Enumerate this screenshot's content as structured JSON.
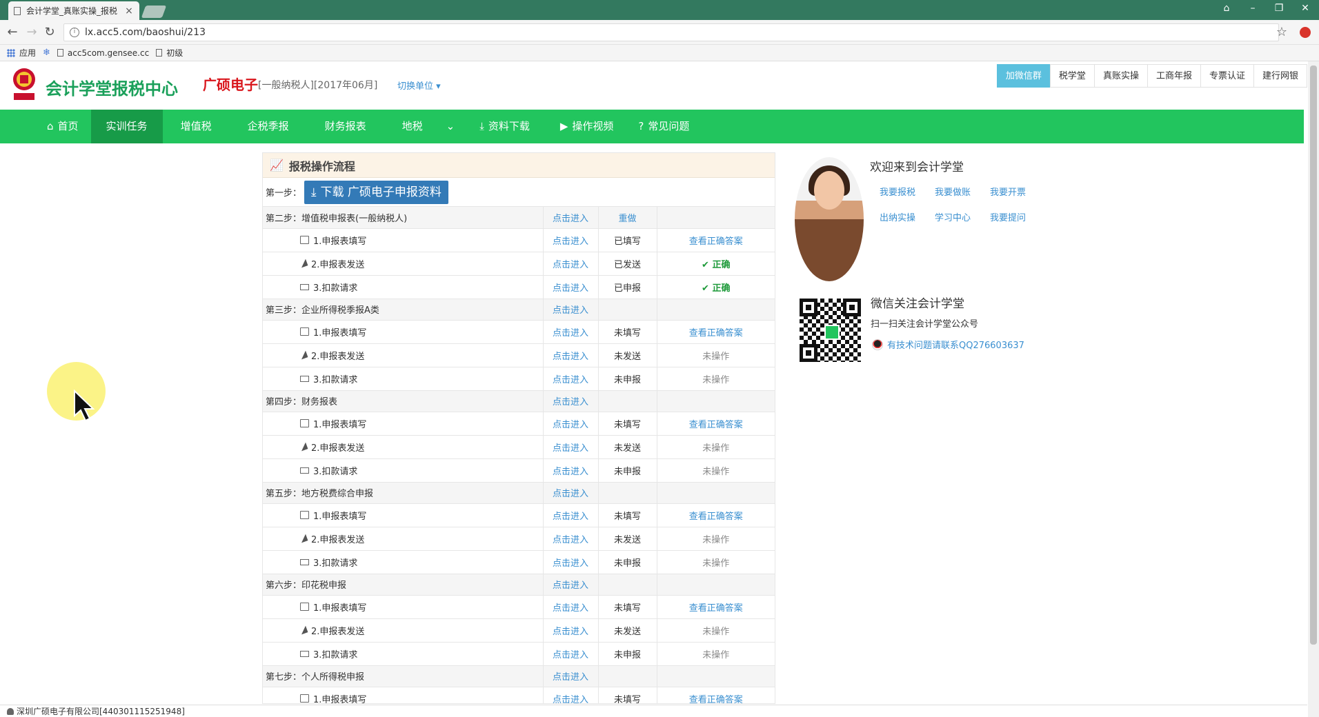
{
  "browser": {
    "tab_title": "会计学堂_真账实操_报税",
    "url": "lx.acc5.com/baoshui/213",
    "bookmarks": [
      "应用",
      "acc5com.gensee.cc",
      "初级"
    ]
  },
  "header": {
    "site_title": "会计学堂报税中心",
    "company": "广硕电子",
    "company_sub": "[一般纳税人][2017年06月]",
    "switch_unit": "切换单位 ▾",
    "top_links": [
      "加微信群",
      "税学堂",
      "真账实操",
      "工商年报",
      "专票认证",
      "建行网银"
    ]
  },
  "nav": {
    "items": [
      "首页",
      "实训任务",
      "增值税",
      "企税季报",
      "财务报表",
      "地税",
      "资料下载",
      "操作视频",
      "常见问题"
    ]
  },
  "panel": {
    "title": "报税操作流程",
    "step1_label": "第一步：",
    "download_label": "下载 广硕电子申报资料",
    "sections": [
      {
        "title": "第二步：增值税申报表(一般纳税人)",
        "link": "点击进入",
        "extra": "重做",
        "rows": [
          {
            "icon": "edit",
            "label": "1.申报表填写",
            "link": "点击进入",
            "status": "已填写",
            "answer": "查看正确答案",
            "kind": "link"
          },
          {
            "icon": "send",
            "label": "2.申报表发送",
            "link": "点击进入",
            "status": "已发送",
            "answer": "✔ 正确",
            "kind": "ok"
          },
          {
            "icon": "mon",
            "label": "3.扣款请求",
            "link": "点击进入",
            "status": "已申报",
            "answer": "✔ 正确",
            "kind": "ok"
          }
        ]
      },
      {
        "title": "第三步：企业所得税季报A类",
        "link": "点击进入",
        "extra": "",
        "rows": [
          {
            "icon": "edit",
            "label": "1.申报表填写",
            "link": "点击进入",
            "status": "未填写",
            "answer": "查看正确答案",
            "kind": "link"
          },
          {
            "icon": "send",
            "label": "2.申报表发送",
            "link": "点击进入",
            "status": "未发送",
            "answer": "未操作",
            "kind": "none"
          },
          {
            "icon": "mon",
            "label": "3.扣款请求",
            "link": "点击进入",
            "status": "未申报",
            "answer": "未操作",
            "kind": "none"
          }
        ]
      },
      {
        "title": "第四步：财务报表",
        "link": "点击进入",
        "extra": "",
        "rows": [
          {
            "icon": "edit",
            "label": "1.申报表填写",
            "link": "点击进入",
            "status": "未填写",
            "answer": "查看正确答案",
            "kind": "link"
          },
          {
            "icon": "send",
            "label": "2.申报表发送",
            "link": "点击进入",
            "status": "未发送",
            "answer": "未操作",
            "kind": "none"
          },
          {
            "icon": "mon",
            "label": "3.扣款请求",
            "link": "点击进入",
            "status": "未申报",
            "answer": "未操作",
            "kind": "none"
          }
        ]
      },
      {
        "title": "第五步：地方税费综合申报",
        "link": "点击进入",
        "extra": "",
        "rows": [
          {
            "icon": "edit",
            "label": "1.申报表填写",
            "link": "点击进入",
            "status": "未填写",
            "answer": "查看正确答案",
            "kind": "link"
          },
          {
            "icon": "send",
            "label": "2.申报表发送",
            "link": "点击进入",
            "status": "未发送",
            "answer": "未操作",
            "kind": "none"
          },
          {
            "icon": "mon",
            "label": "3.扣款请求",
            "link": "点击进入",
            "status": "未申报",
            "answer": "未操作",
            "kind": "none"
          }
        ]
      },
      {
        "title": "第六步：印花税申报",
        "link": "点击进入",
        "extra": "",
        "rows": [
          {
            "icon": "edit",
            "label": "1.申报表填写",
            "link": "点击进入",
            "status": "未填写",
            "answer": "查看正确答案",
            "kind": "link"
          },
          {
            "icon": "send",
            "label": "2.申报表发送",
            "link": "点击进入",
            "status": "未发送",
            "answer": "未操作",
            "kind": "none"
          },
          {
            "icon": "mon",
            "label": "3.扣款请求",
            "link": "点击进入",
            "status": "未申报",
            "answer": "未操作",
            "kind": "none"
          }
        ]
      },
      {
        "title": "第七步：个人所得税申报",
        "link": "点击进入",
        "extra": "",
        "rows": [
          {
            "icon": "edit",
            "label": "1.申报表填写",
            "link": "点击进入",
            "status": "未填写",
            "answer": "查看正确答案",
            "kind": "link"
          }
        ]
      }
    ]
  },
  "sidebar": {
    "welcome": "欢迎来到会计学堂",
    "quick_links": [
      "我要报税",
      "我要做账",
      "我要开票",
      "出纳实操",
      "学习中心",
      "我要提问"
    ],
    "wechat_title": "微信关注会计学堂",
    "wechat_sub": "扫一扫关注会计学堂公众号",
    "qq_text": "有技术问题请联系QQ276603637"
  },
  "status": {
    "text": "深圳广硕电子有限公司[440301115251948]"
  }
}
